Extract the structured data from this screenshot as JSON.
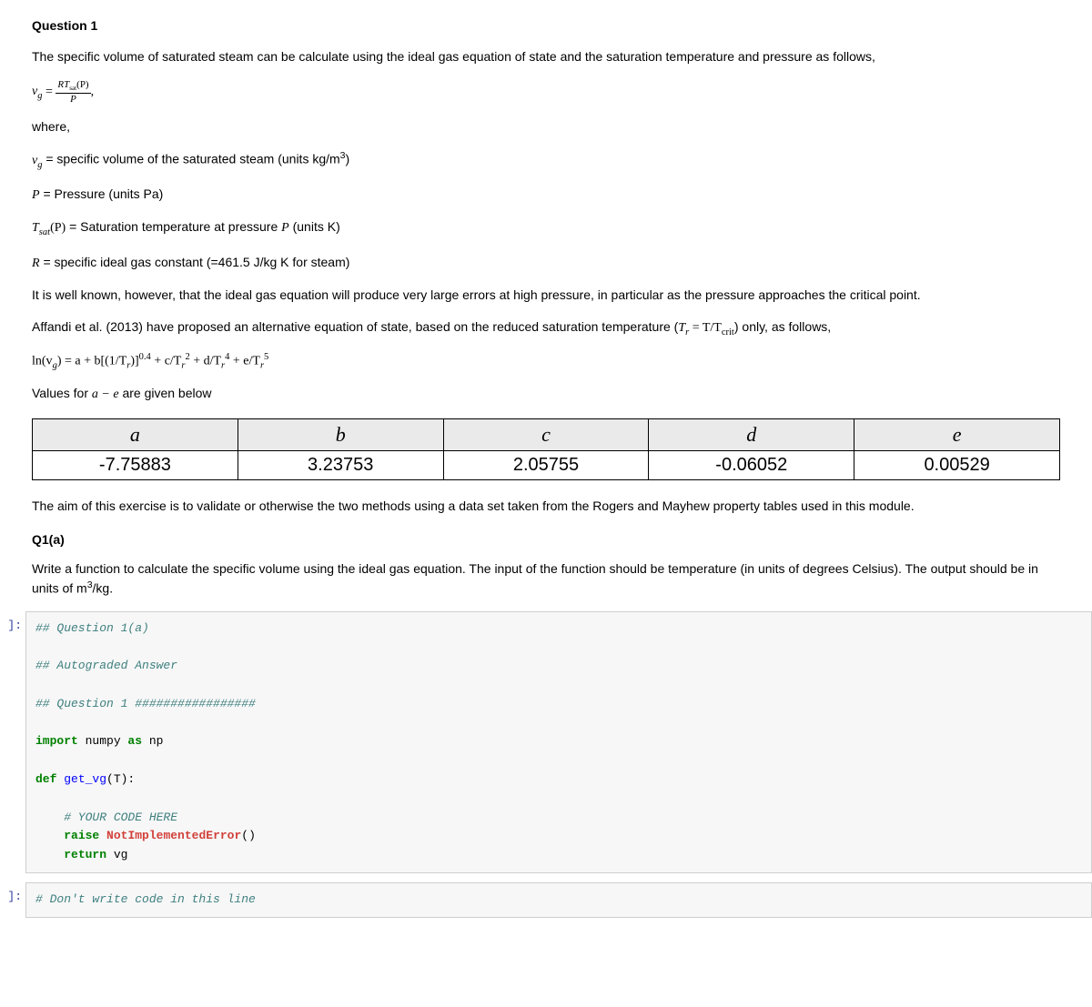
{
  "title": "Question 1",
  "intro": "The specific volume of saturated steam can be calculate using the ideal gas equation of state and the saturation temperature and pressure as follows,",
  "eq1_lhs": "v",
  "eq1_sub": "g",
  "eq1_eq": " = ",
  "eq1_num": "RT",
  "eq1_num_sub": "sat",
  "eq1_num_tail": "(P)",
  "eq1_den": "P",
  "eq1_tail": ",",
  "where": "where,",
  "defs": {
    "vg_pre": "v",
    "vg_sub": "g",
    "vg_text": " = specific volume of the saturated steam (units kg/m",
    "vg_sup": "3",
    "vg_tail": ")",
    "P_pre": "P",
    "P_text": " = Pressure (units Pa)",
    "Tsat_pre": "T",
    "Tsat_sub": "sat",
    "Tsat_mid": "(P)",
    "Tsat_text": " = Saturation temperature at pressure ",
    "Tsat_Pvar": "P",
    "Tsat_tail": " (units K)",
    "R_pre": "R",
    "R_text": " = specific ideal gas constant (=461.5 J/kg K for steam)"
  },
  "para2": "It is well known, however, that the ideal gas equation will produce very large errors at high pressure, in particular as the pressure approaches the critical point.",
  "para3_a": "Affandi et al. (2013) have proposed an alternative equation of state, based on the reduced saturation temperature (",
  "para3_Tr": "T",
  "para3_Tr_sub": "r",
  "para3_eq": " = T/T",
  "para3_crit": "crit",
  "para3_b": ") only, as follows,",
  "eq2_a": "ln(v",
  "eq2_g": "g",
  "eq2_b": ") = a + b[(1/T",
  "eq2_r": "r",
  "eq2_c": ")]",
  "eq2_exp1": "0.4",
  "eq2_d": " + c/T",
  "eq2_exp2": "2",
  "eq2_e": " + d/T",
  "eq2_exp3": "4",
  "eq2_f": " + e/T",
  "eq2_exp4": "5",
  "values_text_a": "Values for ",
  "values_text_ae": "a − e",
  "values_text_b": " are given below",
  "table": {
    "headers": [
      "a",
      "b",
      "c",
      "d",
      "e"
    ],
    "values": [
      "-7.75883",
      "3.23753",
      "2.05755",
      "-0.06052",
      "0.00529"
    ]
  },
  "aim": "The aim of this exercise is to validate or otherwise the two methods using a data set taken from the Rogers and Mayhew property tables used in this module.",
  "q1a_title": "Q1(a)",
  "q1a_text_a": "Write a function to calculate the specific volume using the ideal gas equation. The input of the function should be temperature (in units of degrees Celsius). The output should be in units of m",
  "q1a_sup": "3",
  "q1a_text_b": "/kg.",
  "prompt1": " ]:",
  "code1": {
    "l1": "## Question 1(a)",
    "l2": "## Autograded Answer",
    "l3": "## Question 1 #################",
    "l4a": "import",
    "l4b": " numpy ",
    "l4c": "as",
    "l4d": " np",
    "l5a": "def",
    "l5b": " ",
    "l5c": "get_vg",
    "l5d": "(T):",
    "l6": "    # YOUR CODE HERE",
    "l7a": "    ",
    "l7b": "raise",
    "l7c": " ",
    "l7d": "NotImplementedError",
    "l7e": "()",
    "l8a": "    ",
    "l8b": "return",
    "l8c": " vg"
  },
  "prompt2": " ]:",
  "code2": "# Don't write code in this line"
}
